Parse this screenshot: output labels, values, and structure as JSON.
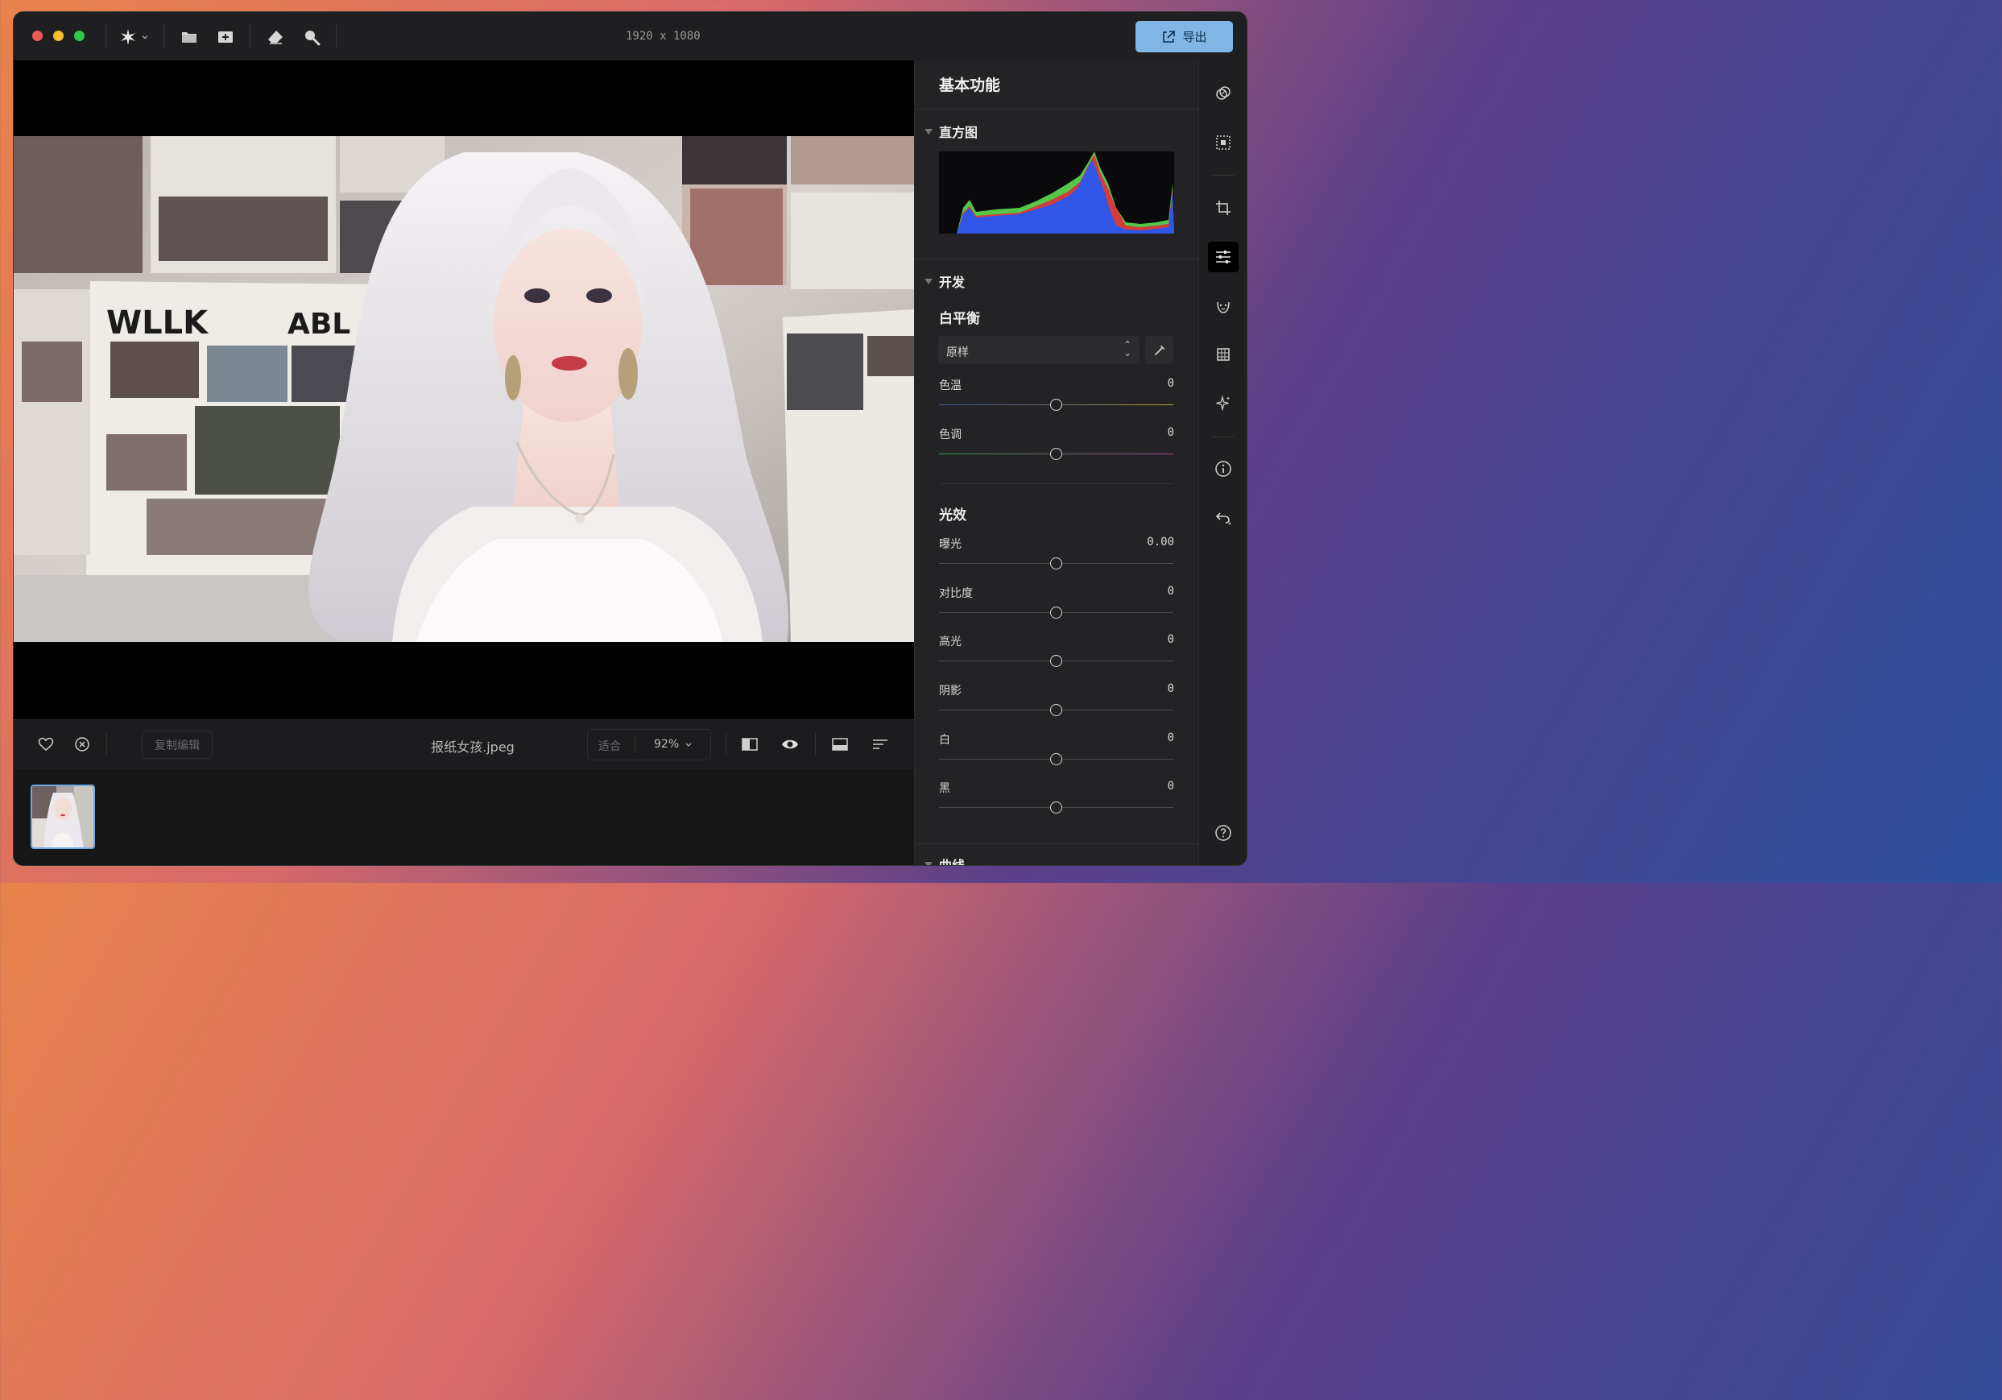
{
  "toolbar": {
    "dimensions": "1920 x 1080",
    "export_label": "导出",
    "traffic_colors": [
      "#ee5a52",
      "#f5be2e",
      "#31c748"
    ],
    "icons": [
      "sparkle-icon",
      "chevron-down-icon",
      "folder-icon",
      "add-image-icon",
      "eraser-icon",
      "search-icon"
    ]
  },
  "canvas": {
    "photo_subject": "white-haired woman before newspaper wall"
  },
  "bottom_bar": {
    "copy_edit_label": "复制编辑",
    "filename": "报纸女孩.jpeg",
    "fit_label": "适合",
    "zoom_value": "92%"
  },
  "panel": {
    "title": "基本功能",
    "histogram_title": "直方图",
    "develop_title": "开发",
    "white_balance_title": "白平衡",
    "white_balance_mode": "原样",
    "wb_sliders": [
      {
        "label": "色温",
        "value": "0"
      },
      {
        "label": "色调",
        "value": "0"
      }
    ],
    "light_title": "光效",
    "light_sliders": [
      {
        "label": "曝光",
        "value": "0.00"
      },
      {
        "label": "对比度",
        "value": "0"
      },
      {
        "label": "高光",
        "value": "0"
      },
      {
        "label": "阴影",
        "value": "0"
      },
      {
        "label": "白",
        "value": "0"
      },
      {
        "label": "黑",
        "value": "0"
      }
    ],
    "curves_title": "曲线"
  },
  "colors": {
    "accent": "#7fb6e6",
    "window_bg": "#1c1c1e",
    "panel_bg": "#232325"
  }
}
